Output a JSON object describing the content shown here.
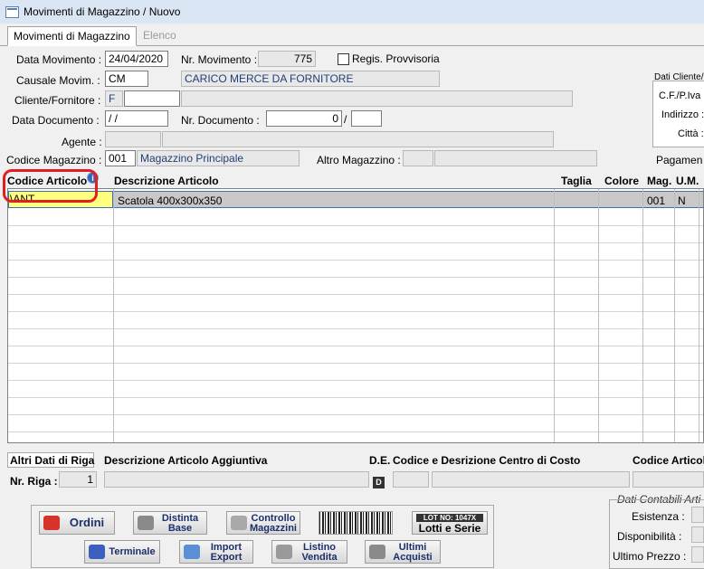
{
  "window": {
    "title": "Movimenti di Magazzino / Nuovo"
  },
  "tabs": [
    {
      "label": "Movimenti di Magazzino"
    },
    {
      "label": "Elenco"
    }
  ],
  "header": {
    "data_movimento_label": "Data Movimento :",
    "data_movimento_value": "24/04/2020",
    "nr_movimento_label": "Nr. Movimento :",
    "nr_movimento_value": "775",
    "regis_provvisoria_label": "Regis. Provvisoria",
    "causale_label": "Causale Movim. :",
    "causale_code": "CM",
    "causale_desc": "CARICO MERCE DA FORNITORE",
    "cliente_label": "Cliente/Fornitore :",
    "cliente_type": "F",
    "cliente_code": "",
    "cliente_name": "",
    "data_documento_label": "Data Documento :",
    "data_documento_value": " / /",
    "nr_documento_label": "Nr. Documento :",
    "nr_documento_value": "0",
    "nr_documento_sep": "/",
    "nr_documento_suffix": "",
    "agente_label": "Agente :",
    "agente_code": "",
    "agente_name": "",
    "codice_magazzino_label": "Codice Magazzino :",
    "codice_magazzino_value": "001",
    "magazzino_desc": "Magazzino Principale",
    "altro_magazzino_label": "Altro Magazzino :",
    "altro_magazzino_code": "",
    "altro_magazzino_desc": ""
  },
  "dati_cliente": {
    "title": "Dati Cliente/",
    "cf_label": "C.F./P.Iva :",
    "indirizzo_label": "Indirizzo :",
    "citta_label": "Città :",
    "pagamento_label": "Pagamen"
  },
  "grid": {
    "columns": [
      "Codice Articolo",
      "Descrizione Articolo",
      "Taglia",
      "Colore",
      "Mag.",
      "U.M."
    ],
    "rows": [
      {
        "codice": "\\ANT",
        "descrizione": "Scatola  400x300x350",
        "taglia": "",
        "colore": "",
        "mag": "001",
        "um": "N"
      }
    ]
  },
  "footer": {
    "altri_dati_label": "Altri Dati di Riga",
    "desc_aggiuntiva_label": "Descrizione Articolo Aggiuntiva",
    "de_label": "D.E.",
    "centro_costo_label": "Codice e Desrizione Centro di Costo",
    "codice_articolo_label": "Codice Articol",
    "nr_riga_label": "Nr. Riga :",
    "nr_riga_value": "1",
    "d_button": "D"
  },
  "toolbar": {
    "ordini": "Ordini",
    "distinta_base_1": "Distinta",
    "distinta_base_2": "Base",
    "controllo_1": "Controllo",
    "controllo_2": "Magazzini",
    "lotti_1": "LOT NO: 1047X",
    "lotti_2": "Lotti e Serie",
    "terminale": "Terminale",
    "import_1": "Import",
    "import_2": "Export",
    "listino_1": "Listino",
    "listino_2": "Vendita",
    "ultimi_1": "Ultimi",
    "ultimi_2": "Acquisti"
  },
  "dati_contabili": {
    "title": "Dati Contabili Arti",
    "esistenza_label": "Esistenza :",
    "disponibilita_label": "Disponibilità :",
    "ultimo_prezzo_label": "Ultimo Prezzo :"
  }
}
